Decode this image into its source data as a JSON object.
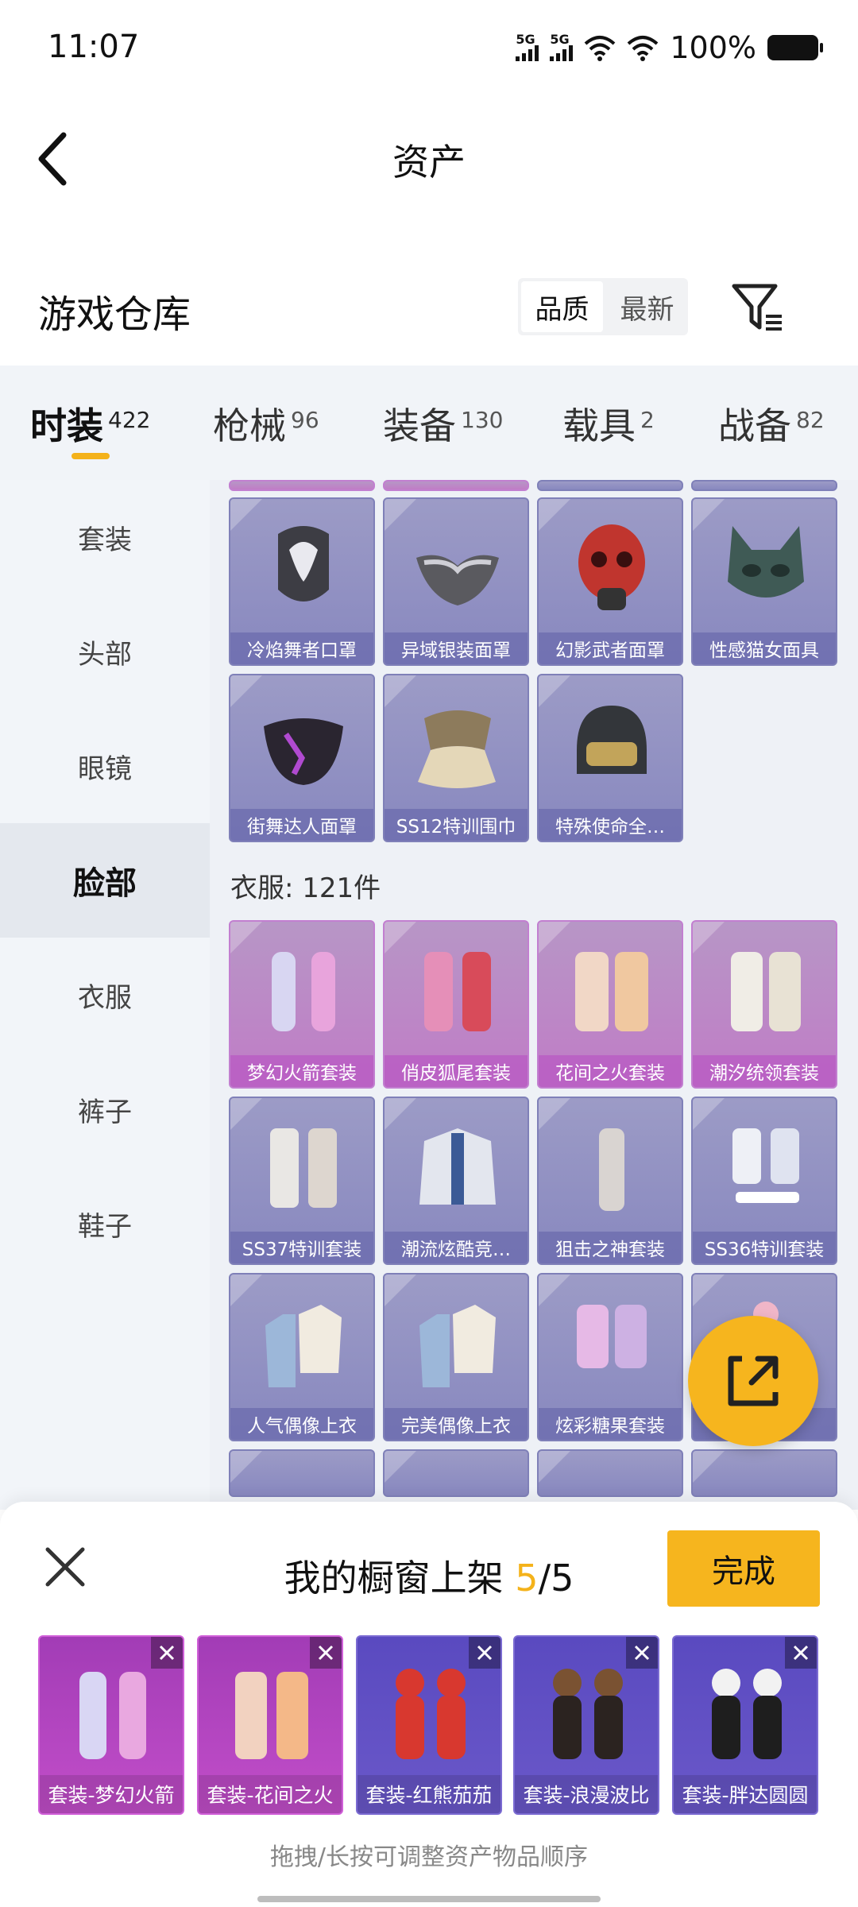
{
  "status_bar": {
    "time": "11:07",
    "net1": "5G",
    "net2": "5G",
    "battery": "100%"
  },
  "header": {
    "title": "资产"
  },
  "section": {
    "title": "游戏仓库",
    "sort_quality": "品质",
    "sort_newest": "最新"
  },
  "tabs": [
    {
      "label": "时装",
      "count": "422"
    },
    {
      "label": "枪械",
      "count": "96"
    },
    {
      "label": "装备",
      "count": "130"
    },
    {
      "label": "载具",
      "count": "2"
    },
    {
      "label": "战备",
      "count": "82"
    }
  ],
  "sidebar": {
    "items": [
      "套装",
      "头部",
      "眼镜",
      "脸部",
      "衣服",
      "裤子",
      "鞋子"
    ],
    "active": "脸部"
  },
  "face_items": [
    "冷焰舞者口罩",
    "异域银装面罩",
    "幻影武者面罩",
    "性感猫女面具",
    "街舞达人面罩",
    "SS12特训围巾",
    "特殊使命全…"
  ],
  "clothes": {
    "heading": "衣服: 121件",
    "items": [
      "梦幻火箭套装",
      "俏皮狐尾套装",
      "花间之火套装",
      "潮汐统领套装",
      "SS37特训套装",
      "潮流炫酷竞…",
      "狙击之神套装",
      "SS36特训套装",
      "人气偶像上衣",
      "完美偶像上衣",
      "炫彩糖果套装",
      "…"
    ]
  },
  "showcase": {
    "title": "我的橱窗上架",
    "count": "5",
    "separator": "/",
    "total": "5",
    "done_label": "完成",
    "items": [
      "套装-梦幻火箭",
      "套装-花间之火",
      "套装-红熊茄茄",
      "套装-浪漫波比",
      "套装-胖达圆圆"
    ],
    "hint": "拖拽/长按可调整资产物品顺序"
  },
  "colors": {
    "accent": "#f6b51e",
    "rare_purple": "#8888bf",
    "legend_pink": "#c07cc6"
  }
}
